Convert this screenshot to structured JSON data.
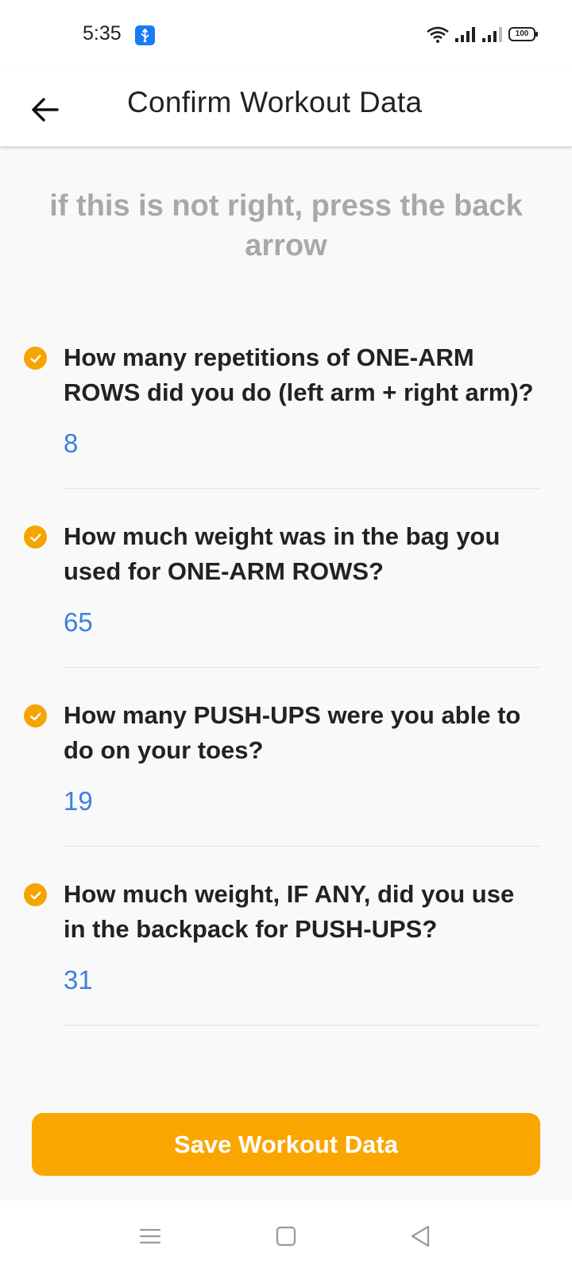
{
  "status_bar": {
    "time": "5:35",
    "battery": "100"
  },
  "header": {
    "title": "Confirm Workout Data"
  },
  "hint": "if this is not right, press the back arrow",
  "questions": [
    {
      "text": "How many repetitions of ONE-ARM ROWS did you do (left arm + right arm)?",
      "answer": "8"
    },
    {
      "text": "How much weight was in the bag you used for ONE-ARM ROWS?",
      "answer": "65"
    },
    {
      "text": "How many PUSH-UPS were you able to do on your toes?",
      "answer": "19"
    },
    {
      "text": "How much weight, IF ANY, did you use in the backpack for PUSH-UPS?",
      "answer": "31"
    }
  ],
  "save_button": {
    "label": "Save Workout Data"
  },
  "colors": {
    "accent": "#fba600",
    "answer": "#3d80df",
    "hint": "#a8a8a8"
  },
  "icons": {
    "back": "arrow-left-icon",
    "check": "check-circle-icon",
    "nav_menu": "menu-icon",
    "nav_home": "square-icon",
    "nav_back": "triangle-back-icon"
  }
}
